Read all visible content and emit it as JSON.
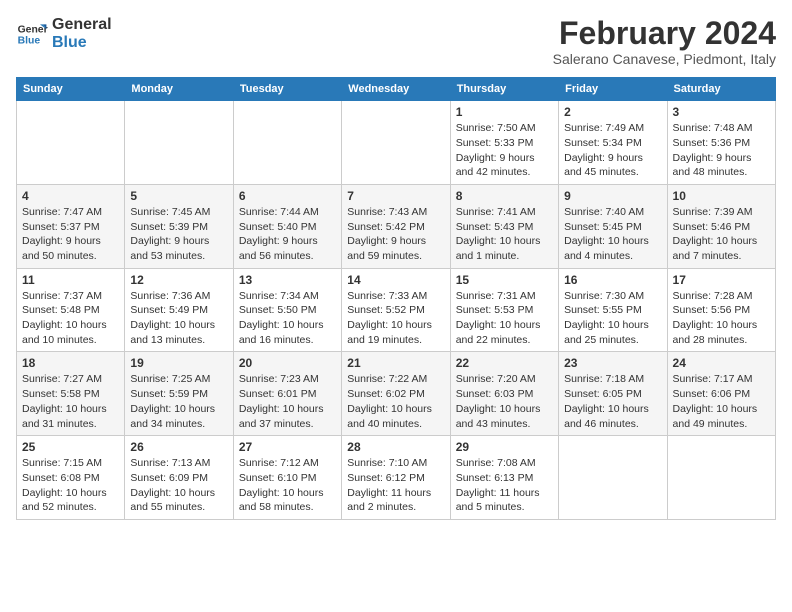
{
  "header": {
    "logo_line1": "General",
    "logo_line2": "Blue",
    "month": "February 2024",
    "location": "Salerano Canavese, Piedmont, Italy"
  },
  "weekdays": [
    "Sunday",
    "Monday",
    "Tuesday",
    "Wednesday",
    "Thursday",
    "Friday",
    "Saturday"
  ],
  "weeks": [
    [
      {
        "day": "",
        "info": ""
      },
      {
        "day": "",
        "info": ""
      },
      {
        "day": "",
        "info": ""
      },
      {
        "day": "",
        "info": ""
      },
      {
        "day": "1",
        "info": "Sunrise: 7:50 AM\nSunset: 5:33 PM\nDaylight: 9 hours\nand 42 minutes."
      },
      {
        "day": "2",
        "info": "Sunrise: 7:49 AM\nSunset: 5:34 PM\nDaylight: 9 hours\nand 45 minutes."
      },
      {
        "day": "3",
        "info": "Sunrise: 7:48 AM\nSunset: 5:36 PM\nDaylight: 9 hours\nand 48 minutes."
      }
    ],
    [
      {
        "day": "4",
        "info": "Sunrise: 7:47 AM\nSunset: 5:37 PM\nDaylight: 9 hours\nand 50 minutes."
      },
      {
        "day": "5",
        "info": "Sunrise: 7:45 AM\nSunset: 5:39 PM\nDaylight: 9 hours\nand 53 minutes."
      },
      {
        "day": "6",
        "info": "Sunrise: 7:44 AM\nSunset: 5:40 PM\nDaylight: 9 hours\nand 56 minutes."
      },
      {
        "day": "7",
        "info": "Sunrise: 7:43 AM\nSunset: 5:42 PM\nDaylight: 9 hours\nand 59 minutes."
      },
      {
        "day": "8",
        "info": "Sunrise: 7:41 AM\nSunset: 5:43 PM\nDaylight: 10 hours\nand 1 minute."
      },
      {
        "day": "9",
        "info": "Sunrise: 7:40 AM\nSunset: 5:45 PM\nDaylight: 10 hours\nand 4 minutes."
      },
      {
        "day": "10",
        "info": "Sunrise: 7:39 AM\nSunset: 5:46 PM\nDaylight: 10 hours\nand 7 minutes."
      }
    ],
    [
      {
        "day": "11",
        "info": "Sunrise: 7:37 AM\nSunset: 5:48 PM\nDaylight: 10 hours\nand 10 minutes."
      },
      {
        "day": "12",
        "info": "Sunrise: 7:36 AM\nSunset: 5:49 PM\nDaylight: 10 hours\nand 13 minutes."
      },
      {
        "day": "13",
        "info": "Sunrise: 7:34 AM\nSunset: 5:50 PM\nDaylight: 10 hours\nand 16 minutes."
      },
      {
        "day": "14",
        "info": "Sunrise: 7:33 AM\nSunset: 5:52 PM\nDaylight: 10 hours\nand 19 minutes."
      },
      {
        "day": "15",
        "info": "Sunrise: 7:31 AM\nSunset: 5:53 PM\nDaylight: 10 hours\nand 22 minutes."
      },
      {
        "day": "16",
        "info": "Sunrise: 7:30 AM\nSunset: 5:55 PM\nDaylight: 10 hours\nand 25 minutes."
      },
      {
        "day": "17",
        "info": "Sunrise: 7:28 AM\nSunset: 5:56 PM\nDaylight: 10 hours\nand 28 minutes."
      }
    ],
    [
      {
        "day": "18",
        "info": "Sunrise: 7:27 AM\nSunset: 5:58 PM\nDaylight: 10 hours\nand 31 minutes."
      },
      {
        "day": "19",
        "info": "Sunrise: 7:25 AM\nSunset: 5:59 PM\nDaylight: 10 hours\nand 34 minutes."
      },
      {
        "day": "20",
        "info": "Sunrise: 7:23 AM\nSunset: 6:01 PM\nDaylight: 10 hours\nand 37 minutes."
      },
      {
        "day": "21",
        "info": "Sunrise: 7:22 AM\nSunset: 6:02 PM\nDaylight: 10 hours\nand 40 minutes."
      },
      {
        "day": "22",
        "info": "Sunrise: 7:20 AM\nSunset: 6:03 PM\nDaylight: 10 hours\nand 43 minutes."
      },
      {
        "day": "23",
        "info": "Sunrise: 7:18 AM\nSunset: 6:05 PM\nDaylight: 10 hours\nand 46 minutes."
      },
      {
        "day": "24",
        "info": "Sunrise: 7:17 AM\nSunset: 6:06 PM\nDaylight: 10 hours\nand 49 minutes."
      }
    ],
    [
      {
        "day": "25",
        "info": "Sunrise: 7:15 AM\nSunset: 6:08 PM\nDaylight: 10 hours\nand 52 minutes."
      },
      {
        "day": "26",
        "info": "Sunrise: 7:13 AM\nSunset: 6:09 PM\nDaylight: 10 hours\nand 55 minutes."
      },
      {
        "day": "27",
        "info": "Sunrise: 7:12 AM\nSunset: 6:10 PM\nDaylight: 10 hours\nand 58 minutes."
      },
      {
        "day": "28",
        "info": "Sunrise: 7:10 AM\nSunset: 6:12 PM\nDaylight: 11 hours\nand 2 minutes."
      },
      {
        "day": "29",
        "info": "Sunrise: 7:08 AM\nSunset: 6:13 PM\nDaylight: 11 hours\nand 5 minutes."
      },
      {
        "day": "",
        "info": ""
      },
      {
        "day": "",
        "info": ""
      }
    ]
  ]
}
